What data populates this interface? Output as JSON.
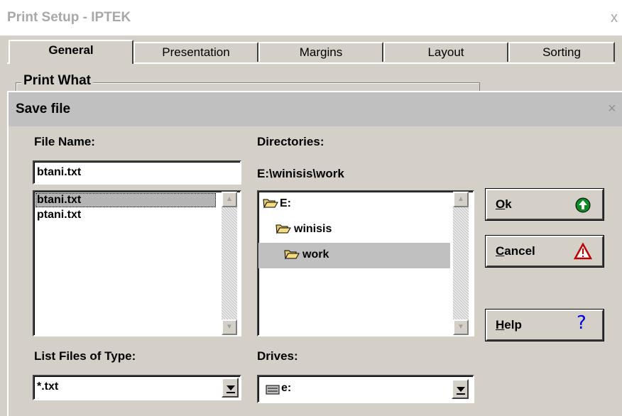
{
  "outer_window": {
    "title": "Print Setup - IPTEK",
    "close_glyph": "x",
    "tabs": [
      "General",
      "Presentation",
      "Margins",
      "Layout",
      "Sorting"
    ],
    "group_label": "Print What"
  },
  "dialog": {
    "title": "Save file",
    "close_glyph": "×",
    "file_name_label": "File Name:",
    "file_name_value": "btani.txt",
    "files": [
      "btani.txt",
      "ptani.txt"
    ],
    "selected_file": "btani.txt",
    "directories_label": "Directories:",
    "current_path": "E:\\winisis\\work",
    "dirs": [
      "E:",
      "winisis",
      "work"
    ],
    "selected_dir": "work",
    "list_type_label": "List Files of Type:",
    "list_type_value": "*.txt",
    "drives_label": "Drives:",
    "drives_value": "e:",
    "buttons": {
      "ok": "Ok",
      "cancel": "Cancel",
      "help": "Help"
    },
    "icons": {
      "ok": "green-up-arrow-icon",
      "cancel": "warning-triangle-icon",
      "help": "question-mark-icon",
      "folder": "open-folder-icon",
      "drive": "drive-icon"
    }
  }
}
